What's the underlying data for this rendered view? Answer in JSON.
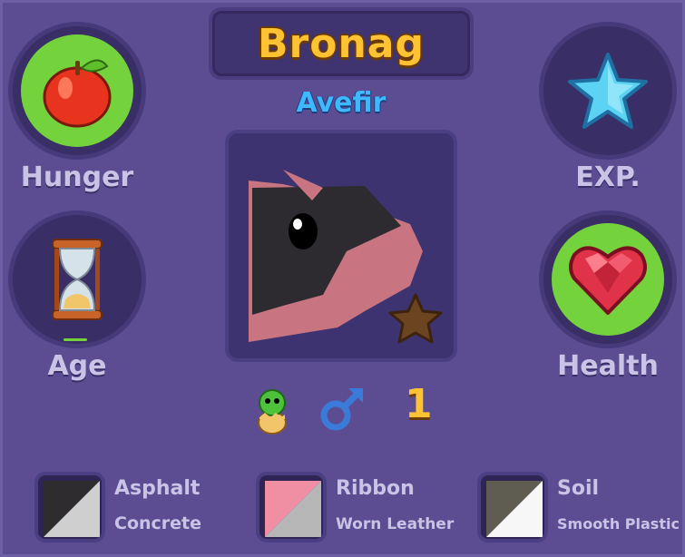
{
  "pet": {
    "name": "Bronag",
    "species": "Avefir",
    "level": "1"
  },
  "stats": {
    "hunger_label": "Hunger",
    "exp_label": "EXP.",
    "age_label": "Age",
    "health_label": "Health"
  },
  "icons": {
    "hunger": "apple-icon",
    "exp": "star-icon",
    "age": "hourglass-icon",
    "health": "heart-icon",
    "stage": "hatchling-egg-icon",
    "gender": "male-icon",
    "rarity": "bronze-star-icon"
  },
  "materials": [
    {
      "primary": "Asphalt",
      "secondary": "Concrete"
    },
    {
      "primary": "Ribbon",
      "secondary": "Worn Leather"
    },
    {
      "primary": "Soil",
      "secondary": "Smooth Plastic"
    }
  ],
  "colors": {
    "background": "#5c4d93",
    "title": "#ffc233",
    "species": "#3fb8ff",
    "stat_fill": "#74d23c",
    "label": "#c9c3e6"
  }
}
